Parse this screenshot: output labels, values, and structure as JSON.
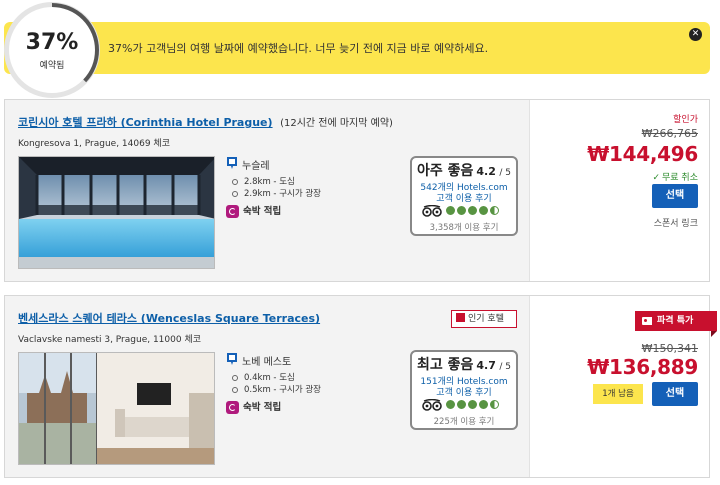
{
  "banner": {
    "percent": "37%",
    "percent_label": "예약됨",
    "booked_fraction": 0.37,
    "message": "37%가 고객님의 여행 날짜에 예약했습니다. 너무 늦기 전에 지금 바로 예약하세요.",
    "bg_color": "#fce54d",
    "close_glyph": "✕"
  },
  "hotels": [
    {
      "name": "코린시아 호텔 프라하 (Corinthia Hotel Prague)",
      "note": "(12시간 전에 마지막 예약)",
      "address": "Kongresova 1, Prague, 14069 체코",
      "location_name": "누슬레",
      "distances": [
        "2.8km - 도심",
        "2.9km - 구시가 광장"
      ],
      "reward_label": "숙박 적립",
      "rating_word": "아주 좋음",
      "rating_score": "4.2",
      "rating_of": "/ 5",
      "review_count": "542개의 Hotels.com",
      "review_sub": "고객 이용 후기",
      "tripadvisor_rating": 4.5,
      "tripadvisor_reviews": "3,358개 이용 후기",
      "discount_label": "할인가",
      "old_price": "₩266,765",
      "price": "₩144,496",
      "free_cancel": "무료 취소",
      "select_label": "선택",
      "sponsor_label": "스폰서 링크"
    },
    {
      "name": "벤세스라스 스퀘어 테라스 (Wenceslas Square Terraces)",
      "badge": "인기 호텔",
      "address": "Vaclavske namesti 3, Prague, 11000 체코",
      "location_name": "노베 메스토",
      "distances": [
        "0.4km - 도심",
        "0.5km - 구시가 광장"
      ],
      "reward_label": "숙박 적립",
      "rating_word": "최고 좋음",
      "rating_score": "4.7",
      "rating_of": "/ 5",
      "review_count": "151개의 Hotels.com",
      "review_sub": "고객 이용 후기",
      "tripadvisor_rating": 4.5,
      "tripadvisor_reviews": "225개 이용 후기",
      "deal_ribbon": "파격 특가",
      "old_price": "₩150,341",
      "price": "₩136,889",
      "rooms_left": "1개 남음",
      "select_label": "선택"
    }
  ],
  "icons": {
    "close": "close-icon",
    "location": "map-pin-icon",
    "reward": "rewards-icon",
    "tripadvisor": "tripadvisor-owl-icon",
    "check": "check-icon",
    "popular": "popular-hotel-icon",
    "deal": "price-tag-icon"
  },
  "colors": {
    "link": "#0d5fa8",
    "price_red": "#c8102e",
    "select_blue": "#1460b8",
    "free_cancel_green": "#2a8a2a",
    "tripadvisor_green": "#589442",
    "reward_magenta": "#b01a7d"
  }
}
